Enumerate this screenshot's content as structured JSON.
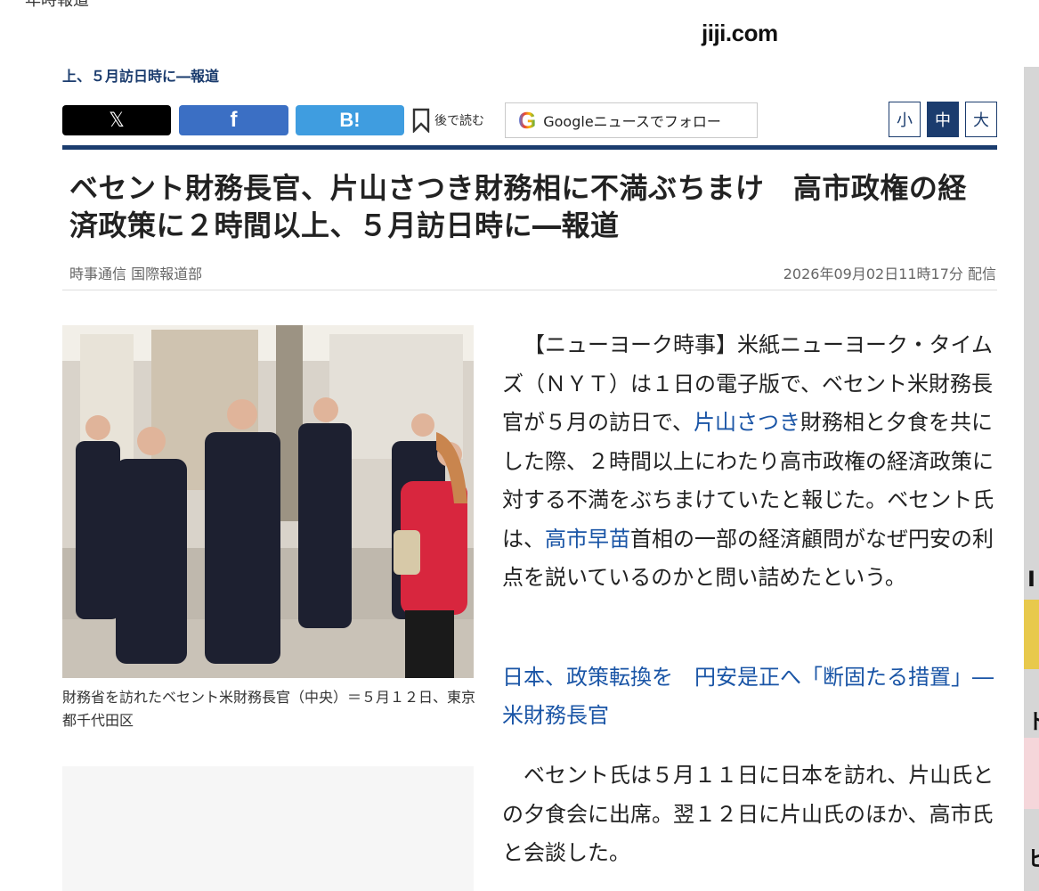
{
  "site": {
    "brand": "jiji.com"
  },
  "top_cutoff_text": "年時報道",
  "mini_headline": "上、５月訪日時に―報道",
  "share": {
    "x_label": "𝕏",
    "facebook_label": "f",
    "hatena_label": "B!",
    "save_later_label": "後で読む",
    "google_g": "G",
    "google_news_label": "Googleニュースでフォロー"
  },
  "font_size_buttons": [
    {
      "label": "小",
      "active": false
    },
    {
      "label": "中",
      "active": true
    },
    {
      "label": "大",
      "active": false
    }
  ],
  "article": {
    "title": "ベセント財務長官、片山さつき財務相に不満ぶちまけ　高市政権の経済政策に２時間以上、５月訪日時に―報道",
    "byline": "時事通信 国際報道部",
    "dateline": "2026年09月02日11時17分 配信",
    "photo_caption": "財務省を訪れたベセント米財務長官（中央）＝５月１２日、東京都千代田区",
    "para1_a": "【ニューヨーク時事】米紙ニューヨーク・タイムズ（ＮＹＴ）は１日の電子版で、ベセント米財務長官が５月の訪日で、",
    "para1_link1": "片山さつき",
    "para1_b": "財務相と夕食を共にした際、２時間以上にわたり高市政権の経済政策に対する不満をぶちまけていたと報じた。ベセント氏は、",
    "para1_link2": "高市早苗",
    "para1_c": "首相の一部の経済顧問がなぜ円安の利点を説いているのかと問い詰めたという。",
    "related_link": "日本、政策転換を　円安是正へ「断固たる措置」―米財務長官",
    "para2": "ベセント氏は５月１１日に日本を訪れ、片山氏との夕食会に出席。翌１２日に片山氏のほか、高市氏と会談した。"
  },
  "sidebar": {
    "marks": [
      "I",
      "ト",
      "ヒ"
    ]
  },
  "colors": {
    "navy": "#1b3c6e",
    "link": "#1a55a6",
    "x": "#000000",
    "facebook": "#3b6fc4",
    "hatena": "#3f9de0"
  }
}
